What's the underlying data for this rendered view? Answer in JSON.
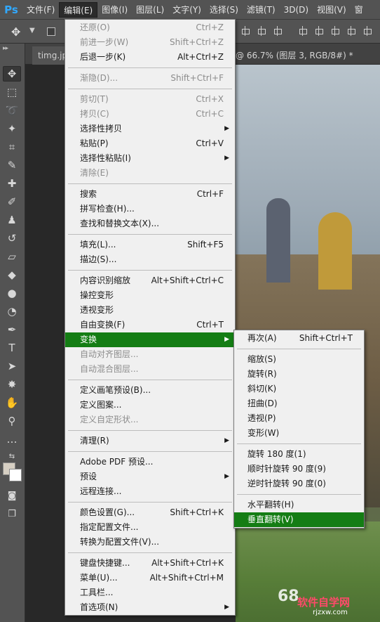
{
  "app": {
    "logo": "Ps"
  },
  "menubar": {
    "items": [
      "文件(F)",
      "编辑(E)",
      "图像(I)",
      "图层(L)",
      "文字(Y)",
      "选择(S)",
      "滤镜(T)",
      "3D(D)",
      "视图(V)",
      "窗"
    ],
    "active": "编辑(E)"
  },
  "options_bar": {
    "tool_icon": "move-icon",
    "dropdown_icon": "chevron-down-icon"
  },
  "document": {
    "tab_label": "timg.jpg",
    "title_suffix": "@ 66.7% (图层 3, RGB/8#) *"
  },
  "toolbar": {
    "tools": [
      "move-icon",
      "marquee-icon",
      "lasso-icon",
      "magic-wand-icon",
      "crop-icon",
      "eyedropper-icon",
      "healing-brush-icon",
      "brush-icon",
      "clone-stamp-icon",
      "history-brush-icon",
      "eraser-icon",
      "paint-bucket-icon",
      "blur-icon",
      "dodge-icon",
      "pen-icon",
      "type-icon",
      "path-selection-icon",
      "custom-shape-icon",
      "hand-icon",
      "zoom-icon",
      "more-tools-icon"
    ],
    "colors": {
      "foreground": "#d6cfc3",
      "background": "#ffffff"
    }
  },
  "edit_menu": {
    "groups": [
      [
        {
          "label": "还原(O)",
          "shortcut": "Ctrl+Z",
          "disabled": true
        },
        {
          "label": "前进一步(W)",
          "shortcut": "Shift+Ctrl+Z",
          "disabled": true
        },
        {
          "label": "后退一步(K)",
          "shortcut": "Alt+Ctrl+Z"
        }
      ],
      [
        {
          "label": "渐隐(D)...",
          "shortcut": "Shift+Ctrl+F",
          "disabled": true
        }
      ],
      [
        {
          "label": "剪切(T)",
          "shortcut": "Ctrl+X",
          "disabled": true
        },
        {
          "label": "拷贝(C)",
          "shortcut": "Ctrl+C",
          "disabled": true
        },
        {
          "label": "选择性拷贝",
          "submenu": true
        },
        {
          "label": "粘贴(P)",
          "shortcut": "Ctrl+V"
        },
        {
          "label": "选择性粘贴(I)",
          "submenu": true
        },
        {
          "label": "清除(E)",
          "disabled": true
        }
      ],
      [
        {
          "label": "搜索",
          "shortcut": "Ctrl+F"
        },
        {
          "label": "拼写检查(H)..."
        },
        {
          "label": "查找和替换文本(X)..."
        }
      ],
      [
        {
          "label": "填充(L)...",
          "shortcut": "Shift+F5"
        },
        {
          "label": "描边(S)..."
        }
      ],
      [
        {
          "label": "内容识别缩放",
          "shortcut": "Alt+Shift+Ctrl+C"
        },
        {
          "label": "操控变形"
        },
        {
          "label": "透视变形"
        },
        {
          "label": "自由变换(F)",
          "shortcut": "Ctrl+T"
        },
        {
          "label": "变换",
          "submenu": true,
          "highlight": true
        },
        {
          "label": "自动对齐图层...",
          "disabled": true
        },
        {
          "label": "自动混合图层...",
          "disabled": true
        }
      ],
      [
        {
          "label": "定义画笔预设(B)..."
        },
        {
          "label": "定义图案..."
        },
        {
          "label": "定义自定形状...",
          "disabled": true
        }
      ],
      [
        {
          "label": "清理(R)",
          "submenu": true
        }
      ],
      [
        {
          "label": "Adobe PDF 预设..."
        },
        {
          "label": "预设",
          "submenu": true
        },
        {
          "label": "远程连接..."
        }
      ],
      [
        {
          "label": "颜色设置(G)...",
          "shortcut": "Shift+Ctrl+K"
        },
        {
          "label": "指定配置文件..."
        },
        {
          "label": "转换为配置文件(V)..."
        }
      ],
      [
        {
          "label": "键盘快捷键...",
          "shortcut": "Alt+Shift+Ctrl+K"
        },
        {
          "label": "菜单(U)...",
          "shortcut": "Alt+Shift+Ctrl+M"
        },
        {
          "label": "工具栏..."
        },
        {
          "label": "首选项(N)",
          "submenu": true
        }
      ]
    ]
  },
  "transform_submenu": {
    "groups": [
      [
        {
          "label": "再次(A)",
          "shortcut": "Shift+Ctrl+T"
        }
      ],
      [
        {
          "label": "缩放(S)"
        },
        {
          "label": "旋转(R)"
        },
        {
          "label": "斜切(K)"
        },
        {
          "label": "扭曲(D)"
        },
        {
          "label": "透视(P)"
        },
        {
          "label": "变形(W)"
        }
      ],
      [
        {
          "label": "旋转 180 度(1)"
        },
        {
          "label": "顺时针旋转 90 度(9)"
        },
        {
          "label": "逆时针旋转 90 度(0)"
        }
      ],
      [
        {
          "label": "水平翻转(H)"
        },
        {
          "label": "垂直翻转(V)",
          "highlight": true
        }
      ]
    ]
  },
  "watermark": {
    "site": "68",
    "brand": "软件自学网",
    "domain": "rjzxw.com"
  },
  "colors": {
    "highlight": "#147d14",
    "menu_bg": "#f0f0f0",
    "chrome_bg": "#535353"
  }
}
